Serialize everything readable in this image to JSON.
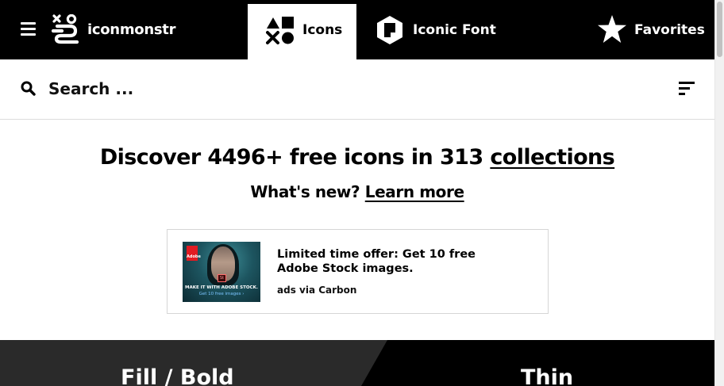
{
  "app": {
    "logo_text": "iconmonstr"
  },
  "nav": {
    "tabs": [
      {
        "label": "Icons",
        "active": true,
        "icon": "shapes-icon"
      },
      {
        "label": "Iconic Font",
        "active": false,
        "icon": "font-tile-icon"
      },
      {
        "label": "Favorites",
        "active": false,
        "icon": "star-icon"
      }
    ]
  },
  "search": {
    "placeholder": "Search ...",
    "value": ""
  },
  "hero": {
    "title_prefix": "Discover 4496+ free icons in 313",
    "title_link": "collections",
    "subtitle_prefix": "What's new?",
    "subtitle_link": "Learn more"
  },
  "ad": {
    "image_caption_main": "MAKE IT WITH ADOBE STOCK.",
    "image_caption_link": "Get 10 free images ›",
    "brand_badge": "Adobe",
    "product_badge": "St",
    "headline": "Limited time offer: Get 10 free Adobe Stock images.",
    "via": "ads via Carbon"
  },
  "styles": {
    "fill_label": "Fill / Bold",
    "thin_label": "Thin"
  },
  "colors": {
    "nav_bg": "#000000",
    "active_tab_bg": "#ffffff",
    "fill_panel_bg": "#2a2a2a",
    "thin_panel_bg": "#000000"
  }
}
